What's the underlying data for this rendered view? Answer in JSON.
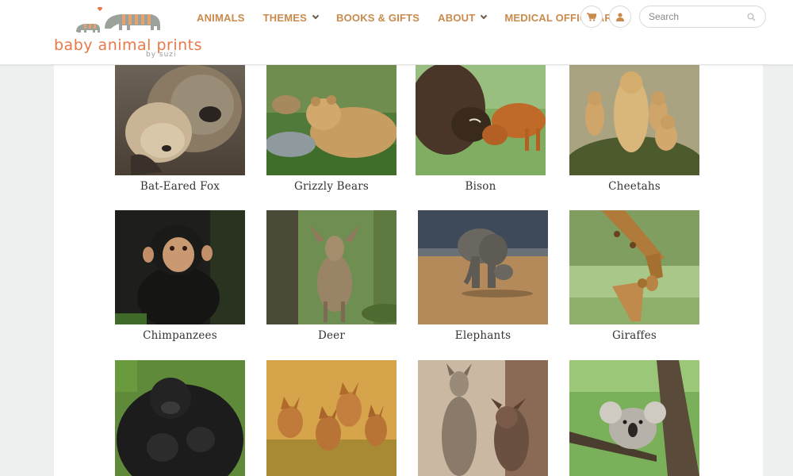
{
  "brand": {
    "name": "baby animal prints",
    "byline": "by suzi",
    "accent": "#e8794a",
    "nav_color": "#c98a4b"
  },
  "nav": [
    {
      "label": "Animals",
      "has_dropdown": false
    },
    {
      "label": "Themes",
      "has_dropdown": true
    },
    {
      "label": "Books & Gifts",
      "has_dropdown": false
    },
    {
      "label": "About",
      "has_dropdown": true
    },
    {
      "label": "Medical Office Art",
      "has_dropdown": false
    }
  ],
  "header_icons": {
    "cart": "cart-icon",
    "account": "user-icon"
  },
  "search": {
    "placeholder": "Search",
    "icon": "search-icon"
  },
  "gallery": [
    {
      "label": "Bat-Eared Fox"
    },
    {
      "label": "Grizzly Bears"
    },
    {
      "label": "Bison"
    },
    {
      "label": "Cheetahs"
    },
    {
      "label": "Chimpanzees"
    },
    {
      "label": "Deer"
    },
    {
      "label": "Elephants"
    },
    {
      "label": "Giraffes"
    },
    {
      "label": ""
    },
    {
      "label": ""
    },
    {
      "label": ""
    },
    {
      "label": ""
    }
  ]
}
